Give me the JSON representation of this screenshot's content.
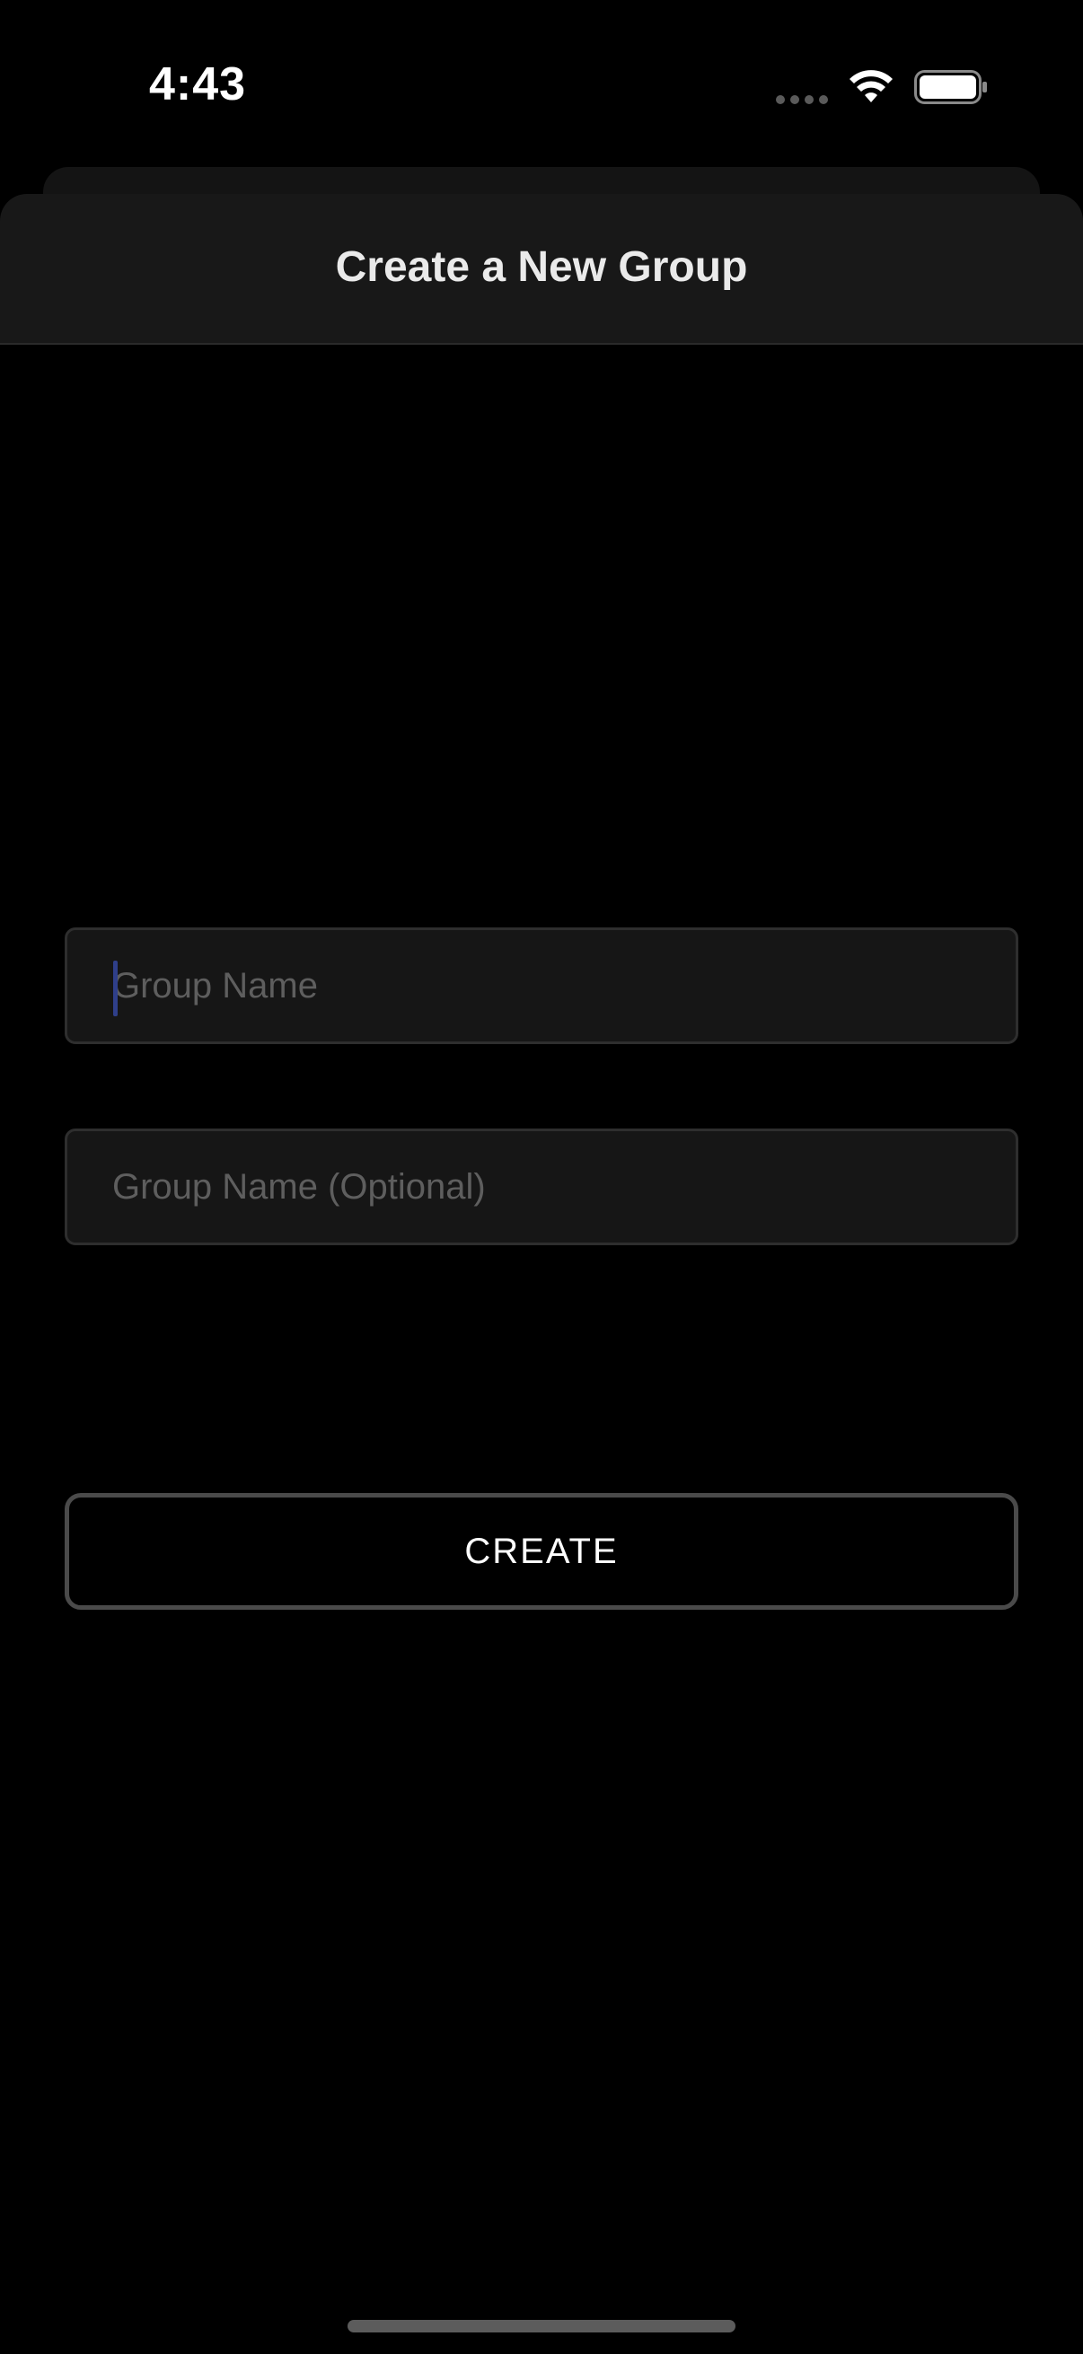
{
  "status_bar": {
    "time": "4:43",
    "icons": [
      "cellular-signal-icon",
      "wifi-icon",
      "battery-icon"
    ]
  },
  "sheet": {
    "title": "Create a New Group"
  },
  "form": {
    "group_name_placeholder": "Group Name",
    "group_name_value": "",
    "group_name_optional_placeholder": "Group Name (Optional)",
    "group_name_optional_value": "",
    "create_label": "CREATE"
  },
  "colors": {
    "background": "#000000",
    "sheet_header": "#181818",
    "input_background": "#161616",
    "input_border": "#2e2e2e",
    "placeholder": "#5e5e5e",
    "cursor": "#2f3f8a",
    "button_border": "#4a4a4a"
  }
}
